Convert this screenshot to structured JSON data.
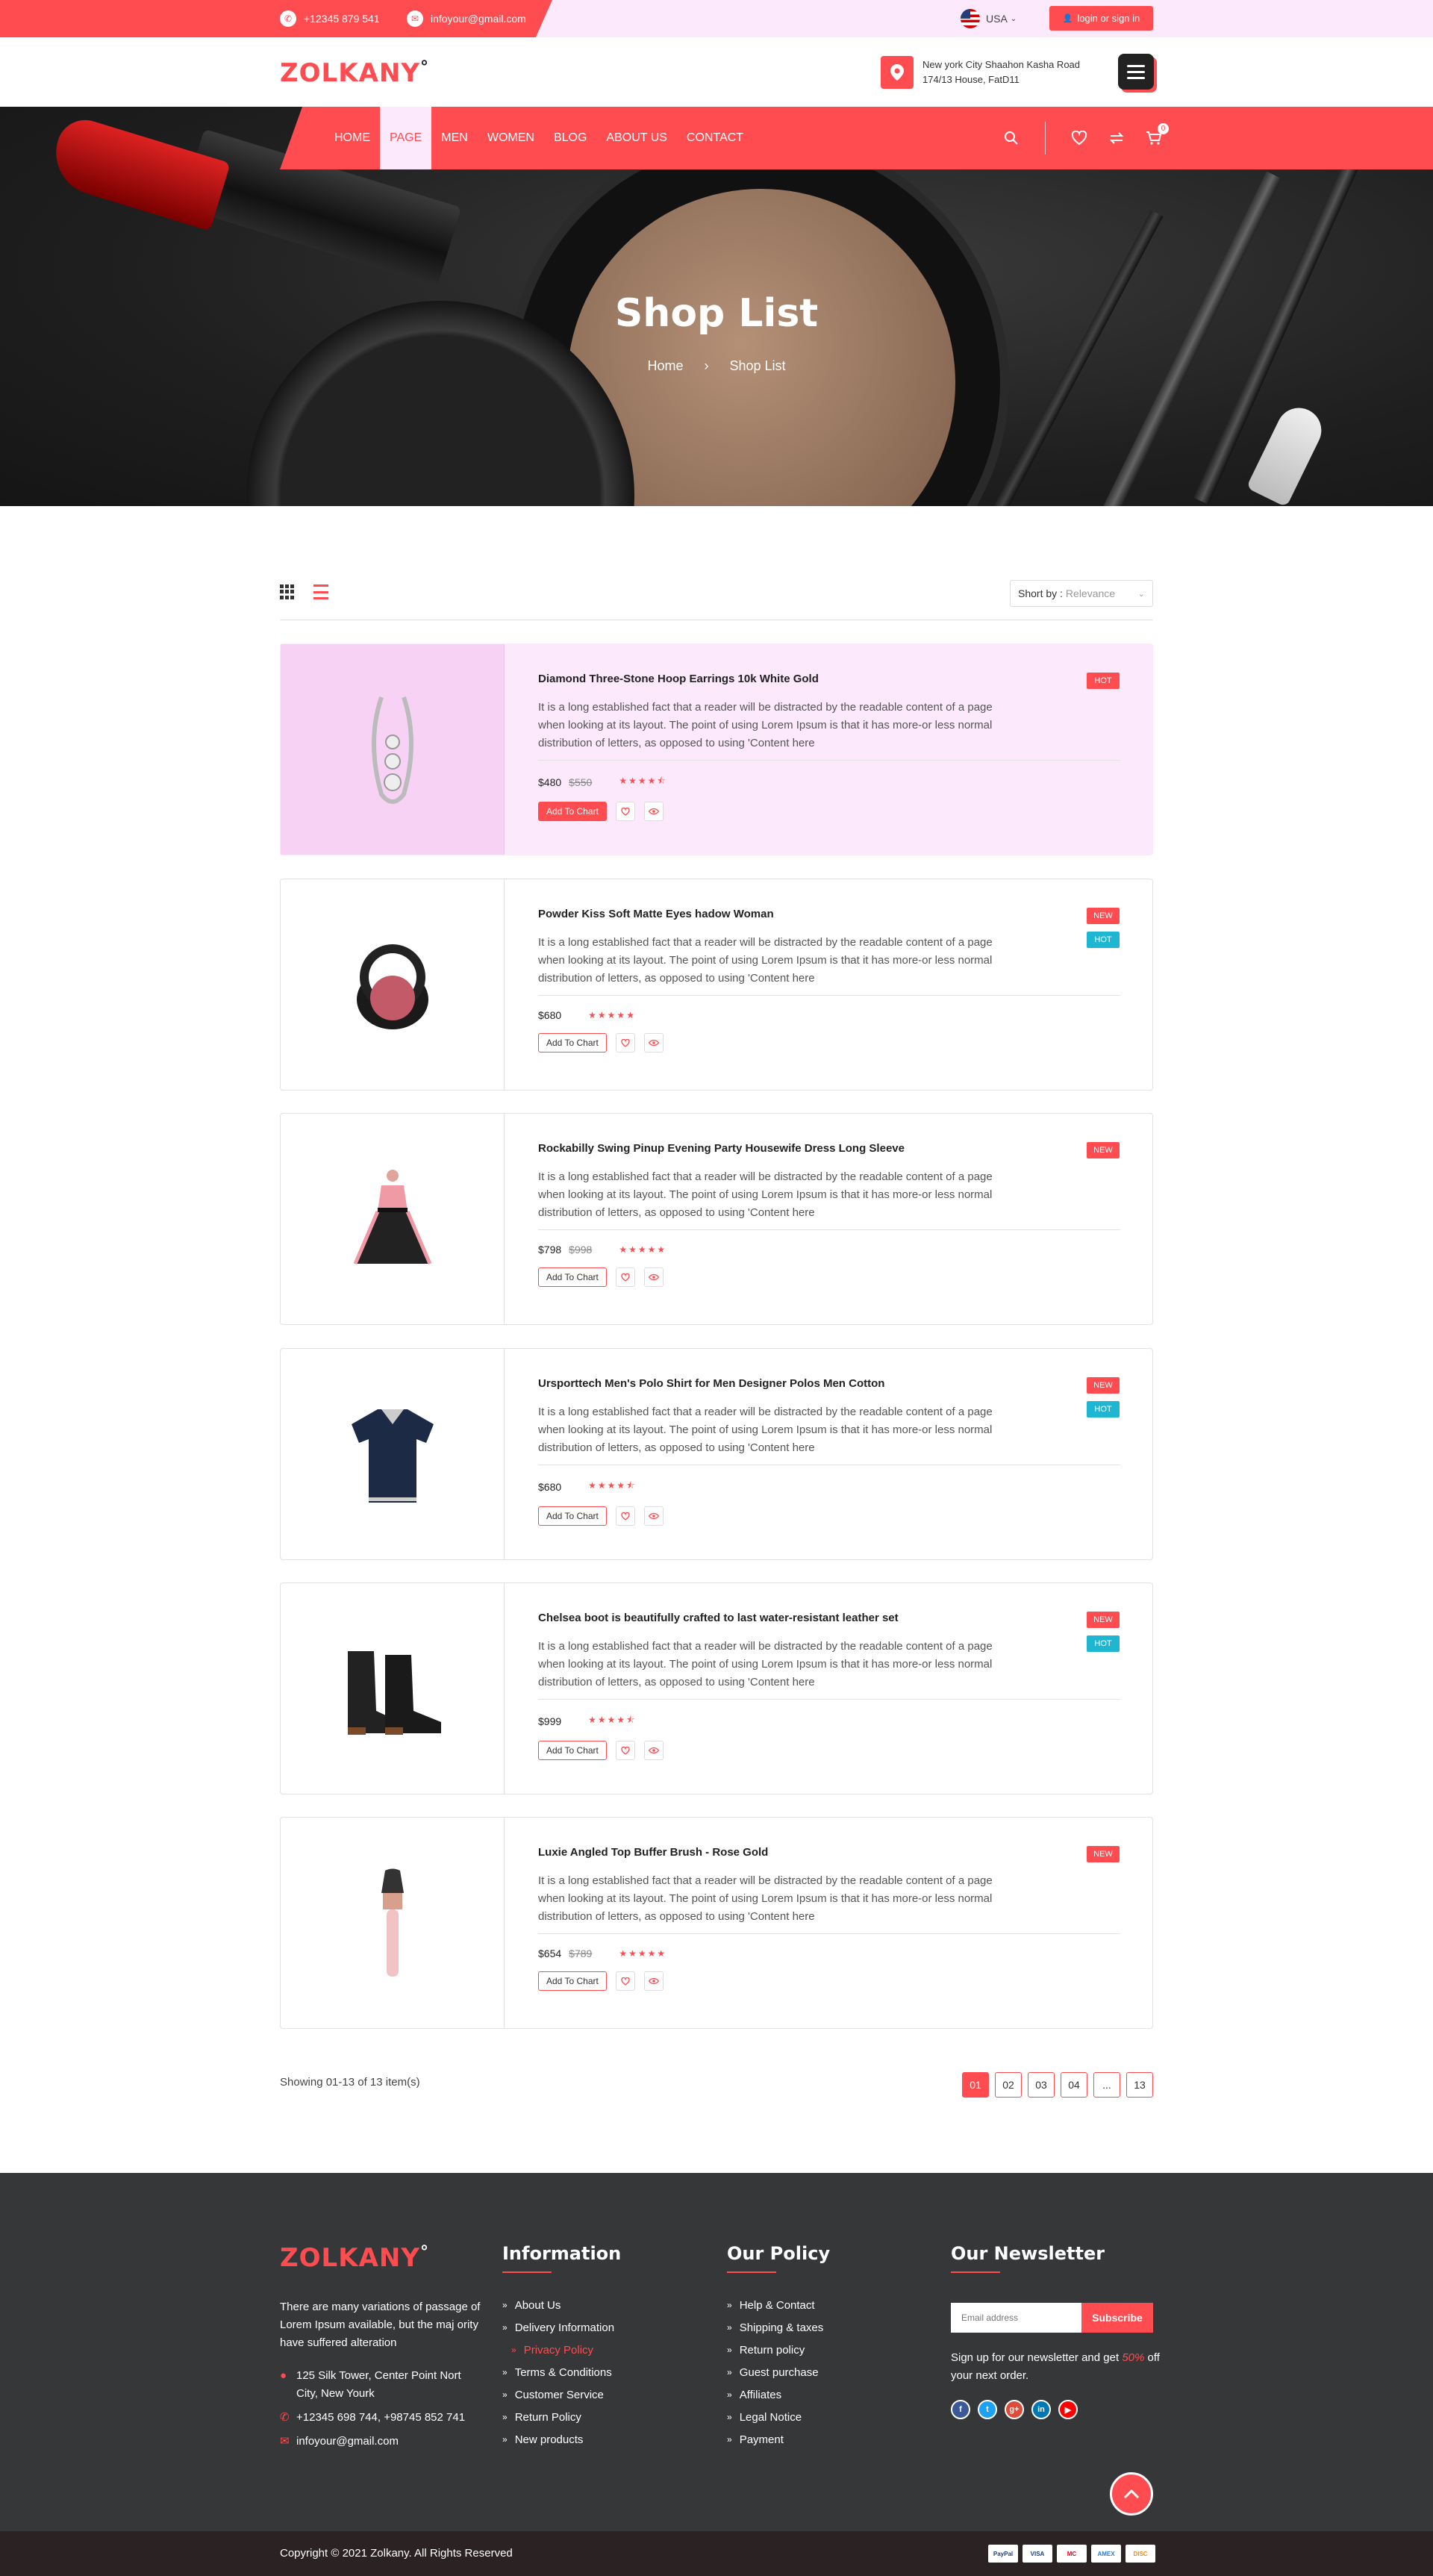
{
  "topbar": {
    "phone": "+12345 879 541",
    "email": "infoyour@gmail.com",
    "country": "USA",
    "login_label": "login or sign in"
  },
  "header": {
    "logo": "ZOLKANY",
    "address_line1": "New york City Shaahon Kasha Road",
    "address_line2": "174/13 House, FatD11"
  },
  "nav": {
    "items": [
      "HOME",
      "PAGE",
      "MEN",
      "WOMEN",
      "BLOG",
      "ABOUT US",
      "CONTACT"
    ],
    "active": "PAGE",
    "cart_count": "0"
  },
  "hero": {
    "title": "Shop List",
    "breadcrumb": [
      "Home",
      "Shop List"
    ]
  },
  "toolbar": {
    "sort_label": "Short by :",
    "sort_value": "Relevance"
  },
  "products": [
    {
      "title": "Diamond Three-Stone Hoop Earrings 10k White Gold",
      "desc": "It is a long established fact that a reader will be distracted by the readable content of a page when looking at its layout. The point of using Lorem Ipsum is that it has more-or less normal distribution of letters, as opposed to using 'Content here",
      "price": "$480",
      "old_price": "$550",
      "rating": 4.5,
      "cart_label": "Add To Chart",
      "badges": [
        "HOT"
      ]
    },
    {
      "title": "Powder Kiss Soft Matte Eyes hadow Woman",
      "desc": "It is a long established fact that a reader will be distracted by the readable content of a page when looking at its layout. The point of using Lorem Ipsum is that it has more-or less normal distribution of letters, as opposed to using 'Content here",
      "price": "$680",
      "old_price": "",
      "rating": 5,
      "cart_label": "Add To Chart",
      "badges": [
        "NEW",
        "HOT"
      ]
    },
    {
      "title": "Rockabilly Swing Pinup Evening Party Housewife Dress Long Sleeve",
      "desc": "It is a long established fact that a reader will be distracted by the readable content of a page when looking at its layout. The point of using Lorem Ipsum is that it has more-or less normal distribution of letters, as opposed to using 'Content here",
      "price": "$798",
      "old_price": "$998",
      "rating": 5,
      "cart_label": "Add To Chart",
      "badges": [
        "NEW"
      ]
    },
    {
      "title": "Ursporttech Men's Polo Shirt for Men Designer Polos Men Cotton",
      "desc": "It is a long established fact that a reader will be distracted by the readable content of a page when looking at its layout. The point of using Lorem Ipsum is that it has more-or less normal distribution of letters, as opposed to using 'Content here",
      "price": "$680",
      "old_price": "",
      "rating": 4.5,
      "cart_label": "Add To Chart",
      "badges": [
        "NEW",
        "HOT"
      ]
    },
    {
      "title": "Chelsea boot is beautifully crafted to last water-resistant leather set",
      "desc": "It is a long established fact that a reader will be distracted by the readable content of a page when looking at its layout. The point of using Lorem Ipsum is that it has more-or less normal distribution of letters, as opposed to using 'Content here",
      "price": "$999",
      "old_price": "",
      "rating": 4.5,
      "cart_label": "Add To Chart",
      "badges": [
        "NEW",
        "HOT"
      ]
    },
    {
      "title": "Luxie  Angled Top Buffer Brush - Rose Gold",
      "desc": "It is a long established fact that a reader will be distracted by the readable content of a page when looking at its layout. The point of using Lorem Ipsum is that it has more-or less normal distribution of letters, as opposed to using 'Content here",
      "price": "$654",
      "old_price": "$789",
      "rating": 5,
      "cart_label": "Add To Chart",
      "badges": [
        "NEW"
      ]
    }
  ],
  "pagination": {
    "showing": "Showing 01-13 of 13 item(s)",
    "pages": [
      "01",
      "02",
      "03",
      "04",
      "...",
      "13"
    ],
    "active": "01"
  },
  "footer": {
    "about": "There are many variations of passage of Lorem Ipsum available, but the maj ority have suffered alteration",
    "address": "125 Silk Tower, Center Point Nort City, New Yourk",
    "phone": "+12345 698 744, +98745 852 741",
    "email": "infoyour@gmail.com",
    "info_title": "Information",
    "info_links": [
      "About Us",
      "Delivery Information",
      "Privacy Policy",
      "Terms & Conditions",
      "Customer Service",
      "Return Policy",
      "New products"
    ],
    "info_active": "Privacy Policy",
    "policy_title": "Our Policy",
    "policy_links": [
      "Help & Contact",
      "Shipping & taxes",
      "Return policy",
      "Guest purchase",
      "Affiliates",
      "Legal Notice",
      "Payment"
    ],
    "newsletter_title": "Our Newsletter",
    "email_placeholder": "Email address",
    "subscribe_label": "Subscribe",
    "nl_text_before": "Sign up for our newsletter and get",
    "nl_discount": "50%",
    "nl_text_after": "off your next order.",
    "socials": [
      {
        "name": "f",
        "color": "#3b5998"
      },
      {
        "name": "t",
        "color": "#1da1f2"
      },
      {
        "name": "g+",
        "color": "#dd4b39"
      },
      {
        "name": "in",
        "color": "#0077b5"
      },
      {
        "name": "▶",
        "color": "#ff0000"
      }
    ],
    "copyright": "Copyright © 2021 Zolkany. All Rights Reserved",
    "payments": [
      "PayPal",
      "VISA",
      "MC",
      "AMEX",
      "DISC"
    ]
  },
  "colors": {
    "accent": "#fe4c50",
    "pink_bg": "#fce9fb",
    "footer_bg": "#363738",
    "teal": "#1fb6d1"
  }
}
